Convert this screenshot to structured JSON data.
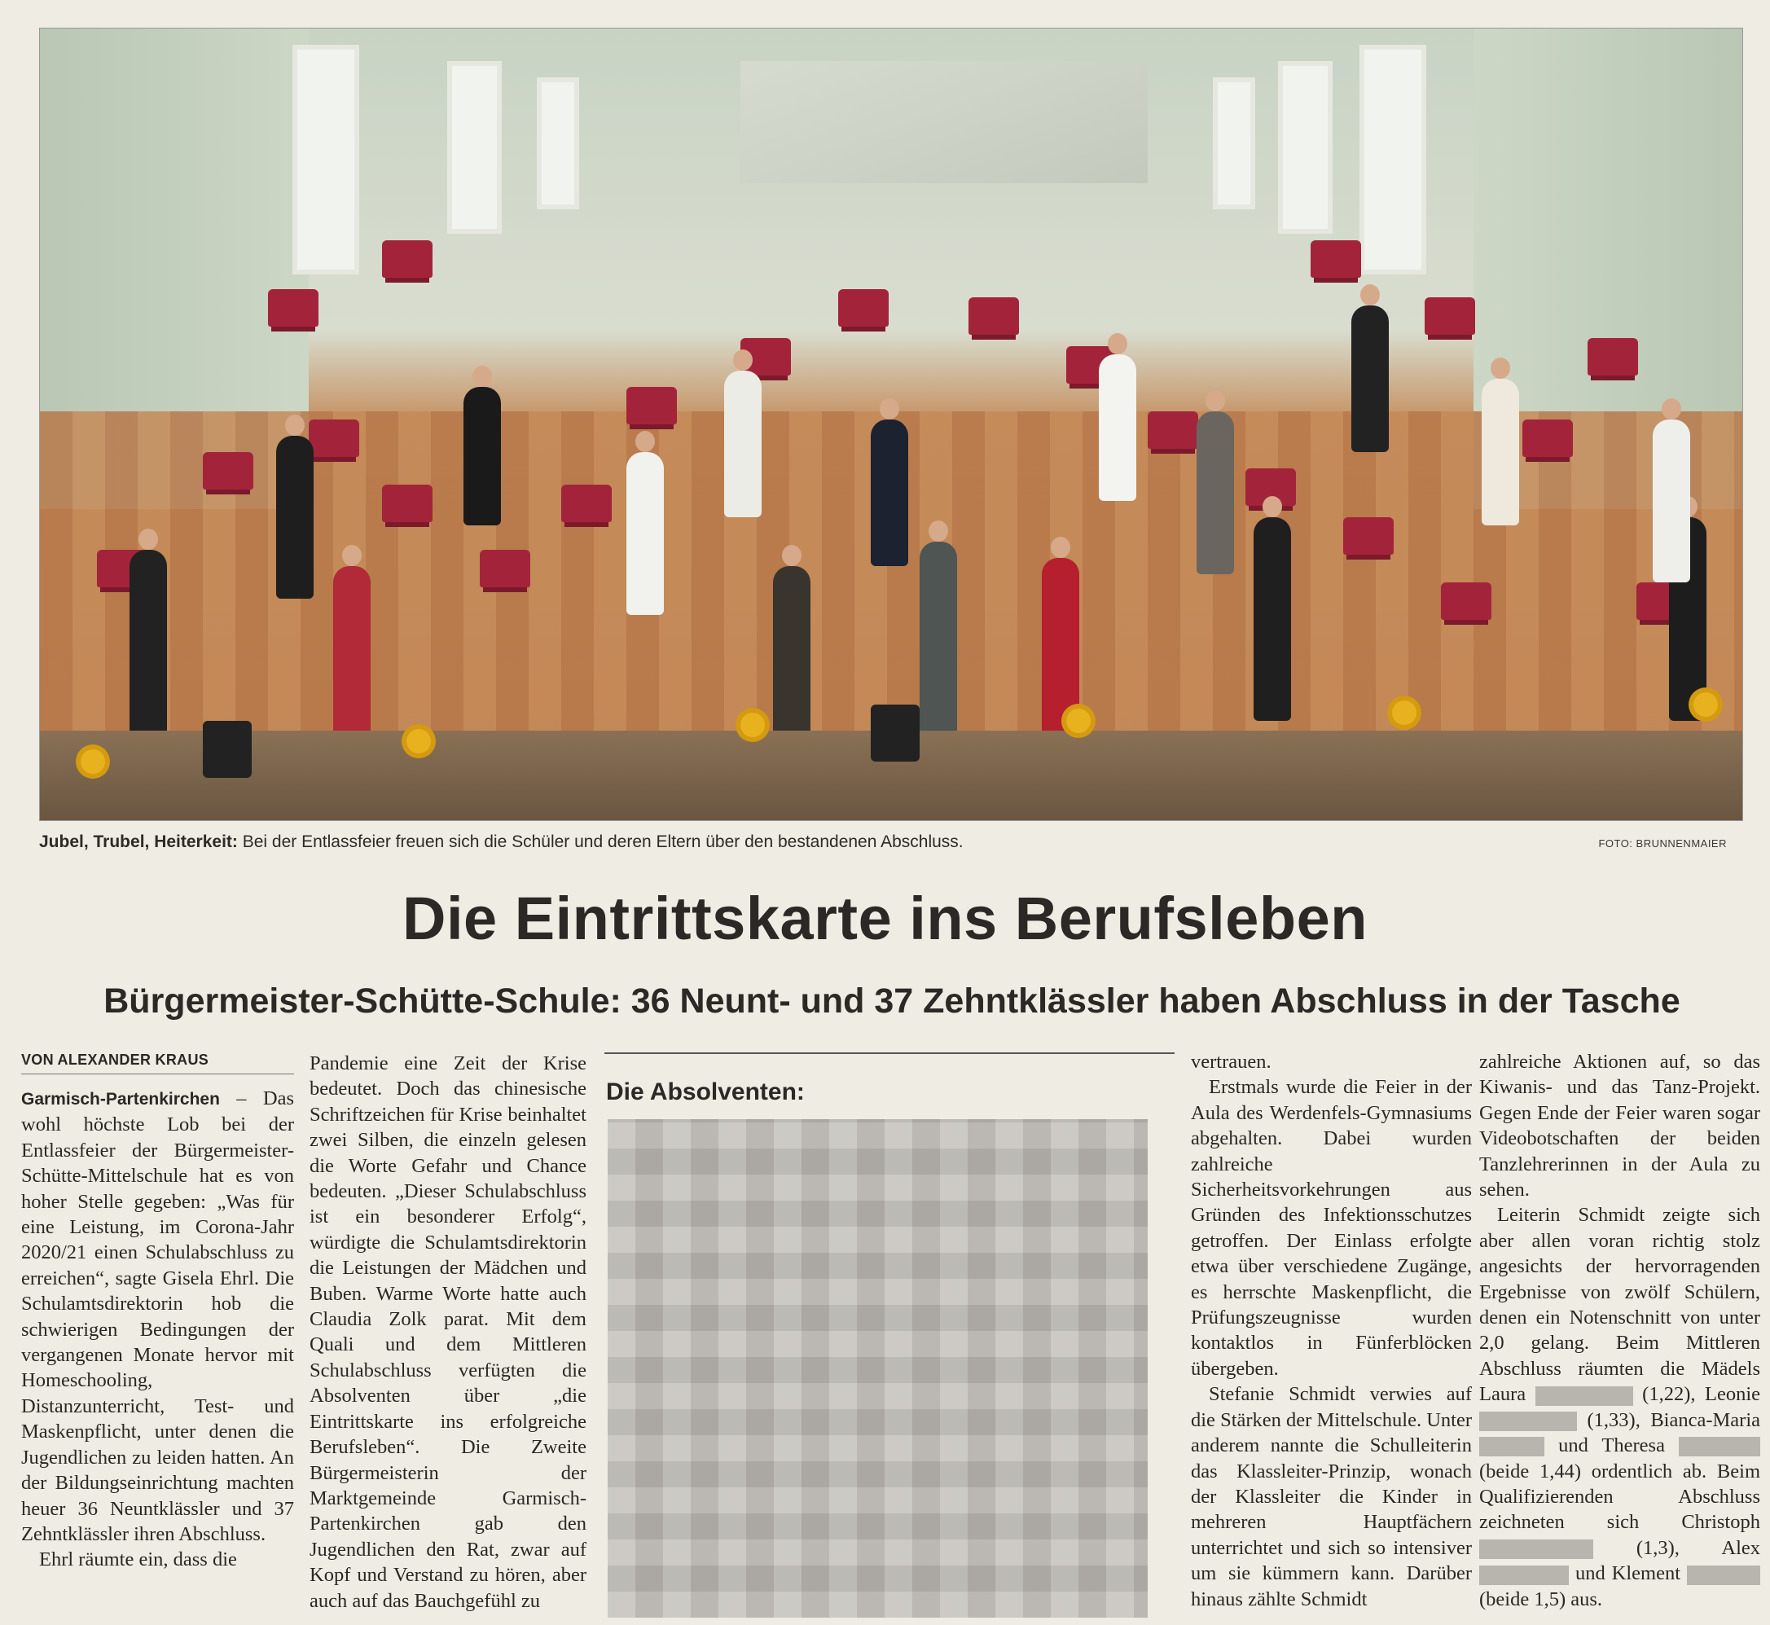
{
  "photo": {
    "caption_lead": "Jubel, Trubel, Heiterkeit:",
    "caption_text": " Bei der Entlassfeier freuen sich die Schüler und deren Eltern über den bestandenen Abschluss.",
    "credit": "FOTO: BRUNNENMAIER"
  },
  "headline": "Die Eintrittskarte ins Berufsleben",
  "subheadline": "Bürgermeister-Schütte-Schule: 36 Neunt- und 37 Zehntklässler haben Abschluss in der Tasche",
  "byline": "VON ALEXANDER KRAUS",
  "article": {
    "dateline": "Garmisch-Partenkirchen",
    "col1_p1": " – Das wohl höchste Lob bei der Entlassfeier der Bürgermeister-Schütte-Mittelschule hat es von hoher Stelle gegeben: „Was für eine Leistung, im Corona-Jahr 2020/21 einen Schulabschluss zu erreichen“, sagte Gisela Ehrl. Die Schulamtsdirektorin hob die schwierigen Bedingungen der vergangenen Monate hervor mit Homeschooling, Distanzunterricht, Test- und Maskenpflicht, unter denen die Jugendlichen zu leiden hatten. An der Bildungseinrichtung machten heuer 36 Neuntklässler und 37 Zehntklässler ihren Abschluss.",
    "col1_p2": "Ehrl räumte ein, dass die",
    "col2_p1": "Pandemie eine Zeit der Krise bedeutet. Doch das chinesische Schriftzeichen für Krise beinhaltet zwei Silben, die einzeln gelesen die Worte Gefahr und Chance bedeuten. „Dieser Schulabschluss ist ein besonderer Erfolg“, würdigte die Schulamtsdirektorin die Leistungen der Mädchen und Buben. Warme Worte hatte auch Claudia Zolk parat. Mit dem Quali und dem Mittleren Schulabschluss verfügten die Absolventen über „die Eintrittskarte ins erfolgreiche Berufsleben“. Die Zweite Bürgermeisterin der Marktgemeinde Garmisch-Partenkirchen gab den Jugendlichen den Rat, zwar auf Kopf und Verstand zu hören, aber auch auf das Bauchgefühl zu",
    "col4_p0": "vertrauen.",
    "col4_p1": "Erstmals wurde die Feier in der Aula des Werdenfels-Gymnasiums abgehalten. Dabei wurden zahlreiche Sicherheitsvorkehrungen aus Gründen des Infektionsschutzes getroffen. Der Einlass erfolgte etwa über verschiedene Zugänge, es herrschte Maskenpflicht, die Prüfungszeugnisse wurden kontaktlos in Fünferblöcken übergeben.",
    "col4_p2": "Stefanie Schmidt verwies auf die Stärken der Mittelschule. Unter anderem nannte die Schulleiterin das Klassleiter-Prinzip, wonach der Klassleiter die Kinder in mehreren Hauptfächern unterrichtet und sich so intensiver um sie kümmern kann. Darüber hinaus zählte Schmidt",
    "col5_p1": "zahlreiche Aktionen auf, so das Kiwanis- und das Tanz-Projekt. Gegen Ende der Feier waren sogar Videobotschaften der beiden Tanzlehrerinnen in der Aula zu sehen.",
    "col5_p2a": "Leiterin Schmidt zeigte sich aber allen voran richtig stolz angesichts der hervorragenden Ergebnisse von zwölf Schülern, denen ein Notenschnitt von unter 2,0 gelang. Beim Mittleren Abschluss räumten die Mädels Laura",
    "col5_p2b": "(1,22), Leonie",
    "col5_p2c": "(1,33), Bianca-Maria",
    "col5_p2d": "und Theresa",
    "col5_p2e": "(beide 1,44) ordentlich ab. Beim Qualifizierenden Abschluss zeichneten sich Christoph",
    "col5_p2f": "(1,3), Alex",
    "col5_p2g": "und Klement",
    "col5_p2h": "(beide 1,5) aus."
  },
  "box": {
    "title": "Die Absolventen:"
  }
}
